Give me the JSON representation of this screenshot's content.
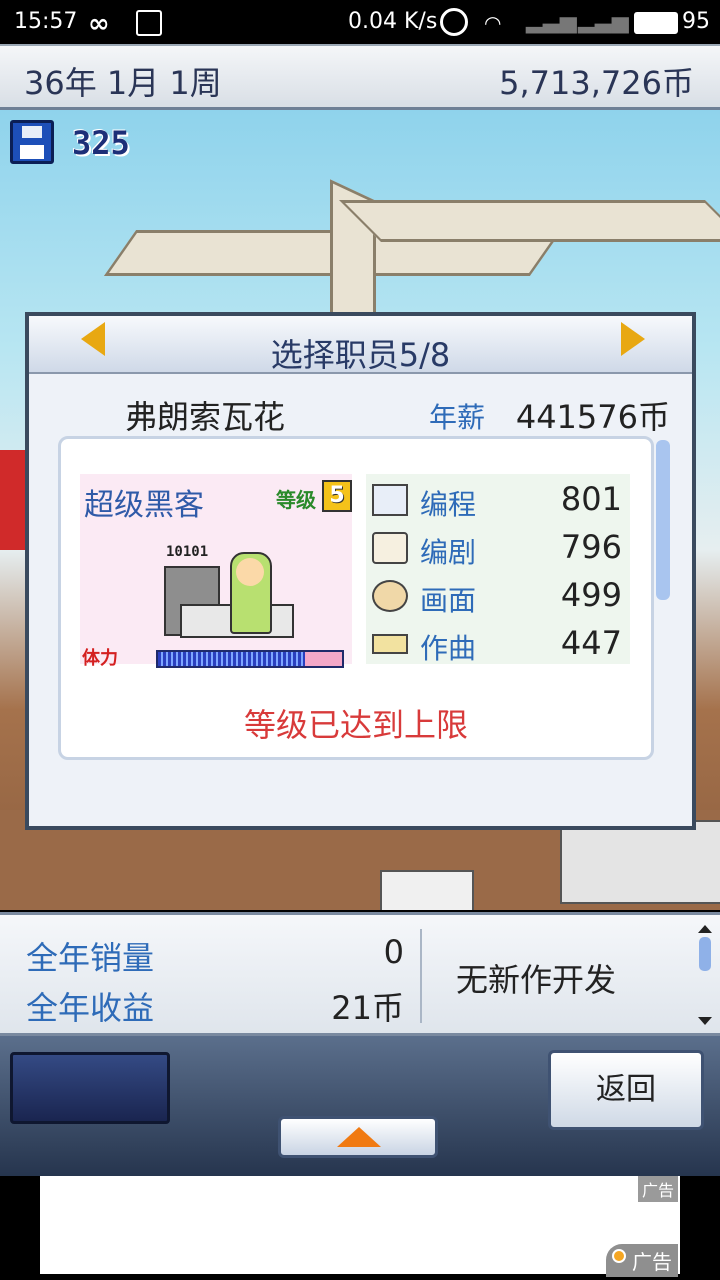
{
  "status_bar": {
    "time": "15:57",
    "net_speed": "0.04 K/s",
    "battery": "95"
  },
  "top_bar": {
    "date": "36年 1月 1周",
    "money": "5,713,726币"
  },
  "save": {
    "count": "325"
  },
  "dialog": {
    "title": "选择职员5/8",
    "employee_name": "弗朗索瓦花",
    "salary_label": "年薪",
    "salary": "441576币",
    "job": "超级黑客",
    "level_label": "等级",
    "level": "5",
    "screen_code": "10101",
    "stamina_label": "体力",
    "stamina_fraction": 0.8,
    "stats": [
      {
        "icon": "computer-icon",
        "label": "编程",
        "value": "801"
      },
      {
        "icon": "book-icon",
        "label": "编剧",
        "value": "796"
      },
      {
        "icon": "palette-icon",
        "label": "画面",
        "value": "499"
      },
      {
        "icon": "trumpet-icon",
        "label": "作曲",
        "value": "447"
      }
    ],
    "limit_message": "等级已达到上限"
  },
  "bottom_panel": {
    "annual_sales_label": "全年销量",
    "annual_sales": "0",
    "annual_revenue_label": "全年收益",
    "annual_revenue": "21币",
    "dev_status": "无新作开发"
  },
  "buttons": {
    "back": "返回"
  },
  "ad": {
    "tag_top": "广告",
    "tag_bottom": "广告"
  }
}
